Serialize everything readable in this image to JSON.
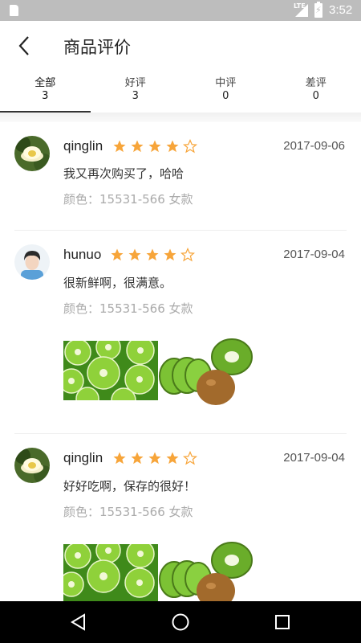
{
  "status_bar": {
    "time": "3:52",
    "network": "LTE",
    "battery_icon": "battery-charging-icon",
    "sd_icon": "sd-card-icon"
  },
  "header": {
    "title": "商品评价",
    "back_icon": "back-arrow-icon"
  },
  "tabs": [
    {
      "label": "全部",
      "count": "3",
      "active": true
    },
    {
      "label": "好评",
      "count": "3",
      "active": false
    },
    {
      "label": "中评",
      "count": "0",
      "active": false
    },
    {
      "label": "差评",
      "count": "0",
      "active": false
    }
  ],
  "reviews": [
    {
      "user": "qinglin",
      "rating": 4,
      "max_rating": 5,
      "date": "2017-09-06",
      "text": "我又再次购买了，哈哈",
      "spec": "颜色：15531-566 女款",
      "avatar": "flower-avatar",
      "photos": []
    },
    {
      "user": "hunuo",
      "rating": 4,
      "max_rating": 5,
      "date": "2017-09-04",
      "text": "很新鲜啊，很满意。",
      "spec": "颜色：15531-566 女款",
      "avatar": "person-avatar",
      "photos": [
        "kiwi-slices-photo",
        "kiwi-halves-photo"
      ]
    },
    {
      "user": "qinglin",
      "rating": 4,
      "max_rating": 5,
      "date": "2017-09-04",
      "text": "好好吃啊，保存的很好！",
      "spec": "颜色：15531-566 女款",
      "avatar": "flower-avatar",
      "photos": [
        "kiwi-slices-photo",
        "kiwi-halves-photo"
      ]
    }
  ],
  "nav_bar": {
    "back": "nav-back-icon",
    "home": "nav-home-icon",
    "recents": "nav-recents-icon"
  },
  "colors": {
    "star": "#f7a53a",
    "status_bar": "#bdbdbd",
    "nav_bar": "#000000"
  }
}
